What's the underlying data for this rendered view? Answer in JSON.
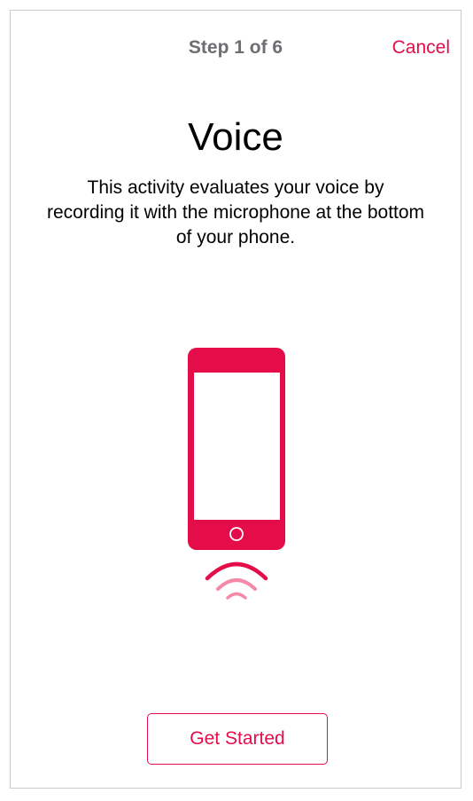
{
  "nav": {
    "title": "Step 1 of 6",
    "cancel_label": "Cancel"
  },
  "content": {
    "title": "Voice",
    "description": "This activity evaluates your voice by recording it with the microphone at the bottom of your phone."
  },
  "illustration": {
    "icon": "phone-with-microphone-waves-icon"
  },
  "actions": {
    "get_started_label": "Get Started"
  },
  "colors": {
    "accent": "#e40d4a",
    "accent_light": "#f48aa8",
    "nav_title": "#6d6d72"
  }
}
